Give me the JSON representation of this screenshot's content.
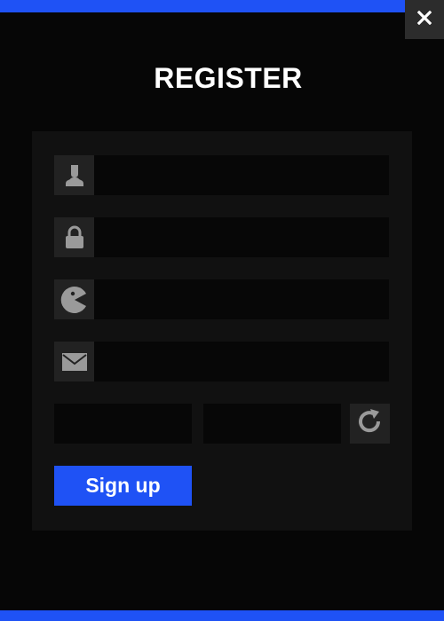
{
  "window": {
    "close_label": "X"
  },
  "header": {
    "title": "REGISTER"
  },
  "form": {
    "fields": [
      {
        "icon": "user-icon",
        "value": "",
        "placeholder": ""
      },
      {
        "icon": "lock-icon",
        "value": "",
        "placeholder": ""
      },
      {
        "icon": "pacman-icon",
        "value": "",
        "placeholder": ""
      },
      {
        "icon": "envelope-icon",
        "value": "",
        "placeholder": ""
      }
    ],
    "captcha": {
      "code_value": "",
      "answer_value": "",
      "refresh_icon": "refresh-icon"
    },
    "signup_label": "Sign up"
  },
  "colors": {
    "accent": "#1f52f5",
    "background": "#060606",
    "panel": "#111111",
    "input": "#070707",
    "icon_box": "#222222",
    "icon": "#9a9a9a"
  }
}
